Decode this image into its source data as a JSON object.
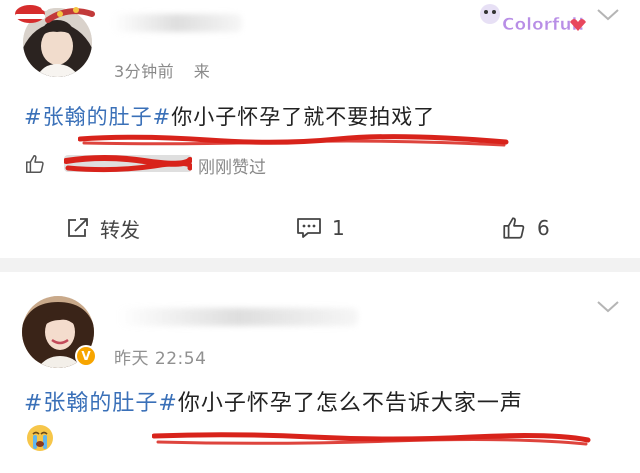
{
  "post1": {
    "time": "3分钟前",
    "source": "来",
    "topic": "#张翰的肚子#",
    "text": "你小子怀孕了就不要拍戏了",
    "liked_suffix": "刚刚赞过",
    "actions": {
      "repost_label": "转发",
      "comment_count": "1",
      "like_count": "6"
    },
    "sticker_text": "Colorful!"
  },
  "post2": {
    "time": "昨天 22:54",
    "topic": "#张翰的肚子#",
    "text": "你小子怀孕了怎么不告诉大家一声",
    "verified_badge": "V"
  },
  "icons": [
    "thumb-up-icon",
    "repost-icon",
    "comment-icon",
    "chevron-down-icon",
    "crying-emoji-icon"
  ],
  "colors": {
    "topic_blue": "#3a70b8",
    "redaction_red": "#d8231b",
    "divider_gray": "#f2f2f2",
    "verified_orange": "#f7a500"
  }
}
